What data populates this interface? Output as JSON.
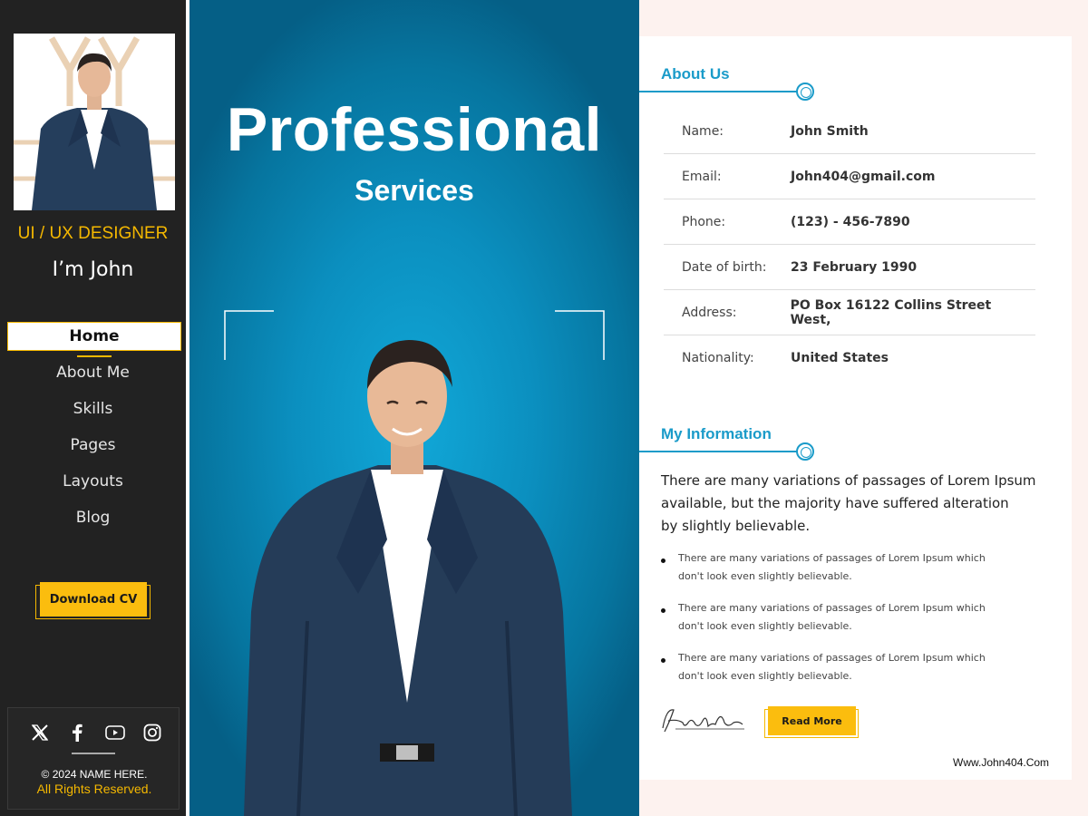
{
  "sidebar": {
    "role": "UI / UX DESIGNER",
    "greeting": "I’m John",
    "nav": [
      "Home",
      "About Me",
      "Skills",
      "Pages",
      "Layouts",
      "Blog"
    ],
    "active": "Home",
    "download_label": "Download CV",
    "social": [
      "x-icon",
      "facebook-icon",
      "youtube-icon",
      "instagram-icon"
    ],
    "copyright": "© 2024 NAME HERE.",
    "rights": "All Rights Reserved."
  },
  "hero": {
    "title": "Professional",
    "subtitle": "Services"
  },
  "about": {
    "heading": "About Us",
    "rows": [
      {
        "label": "Name:",
        "value": "John Smith"
      },
      {
        "label": "Email:",
        "value": "John404@gmail.com"
      },
      {
        "label": "Phone:",
        "value": "(123) - 456-7890"
      },
      {
        "label": "Date of birth:",
        "value": "23 February 1990"
      },
      {
        "label": "Address:",
        "value": "PO Box 16122 Collins Street West,"
      },
      {
        "label": "Nationality:",
        "value": "United States"
      }
    ]
  },
  "info": {
    "heading": "My Information",
    "intro_lines": [
      "There are many variations of passages of Lorem Ipsum",
      "available, but the majority have suffered alteration",
      "by slightly believable."
    ],
    "bullets": [
      [
        "There are many variations of passages of Lorem Ipsum which",
        "don't look even slightly believable."
      ],
      [
        "There are many variations of passages of Lorem Ipsum which",
        "don't look even slightly believable."
      ],
      [
        "There are many variations of passages of Lorem Ipsum which",
        "don't look even slightly believable."
      ]
    ],
    "read_more": "Read More",
    "website": "Www.John404.Com"
  },
  "colors": {
    "accent": "#fbbd0e",
    "heading_blue": "#1a9bc9",
    "sidebar_bg": "#222222"
  }
}
